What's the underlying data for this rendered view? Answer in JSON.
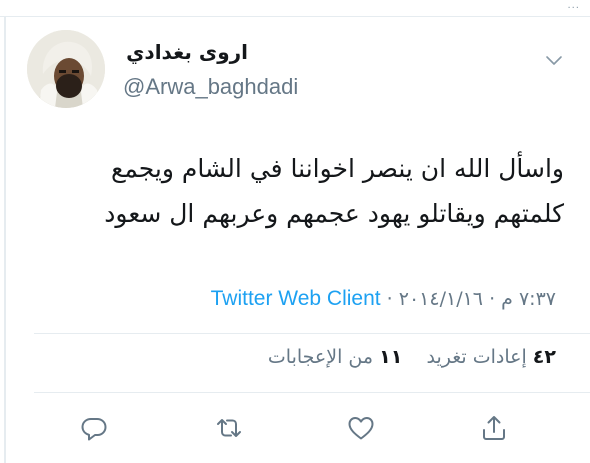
{
  "header": {
    "overflow_dots": "..."
  },
  "tweet": {
    "display_name": "اروى بغدادي",
    "handle": "@Arwa_baghdadi",
    "text_line_1": "واسأل الله ان ينصر اخواننا في الشام ويجمع",
    "text_line_2": "كلمتهم ويقاتلو يهود عجمهم وعربهم ال سعود",
    "time": "٧:٣٧ م",
    "separator": "·",
    "date": "٢٠١٤/١/١٦",
    "client": "Twitter Web Client"
  },
  "stats": {
    "retweets_count": "٤٢",
    "retweets_label": "إعادات تغريد",
    "likes_count": "١١",
    "likes_label": "من الإعجابات"
  },
  "icons": {
    "menu": "chevron-down-icon",
    "reply": "reply-icon",
    "retweet": "retweet-icon",
    "like": "heart-icon",
    "share": "share-icon"
  },
  "colors": {
    "link": "#1da1f2",
    "muted": "#657786",
    "text": "#14171a",
    "divider": "#e6ecf0"
  }
}
